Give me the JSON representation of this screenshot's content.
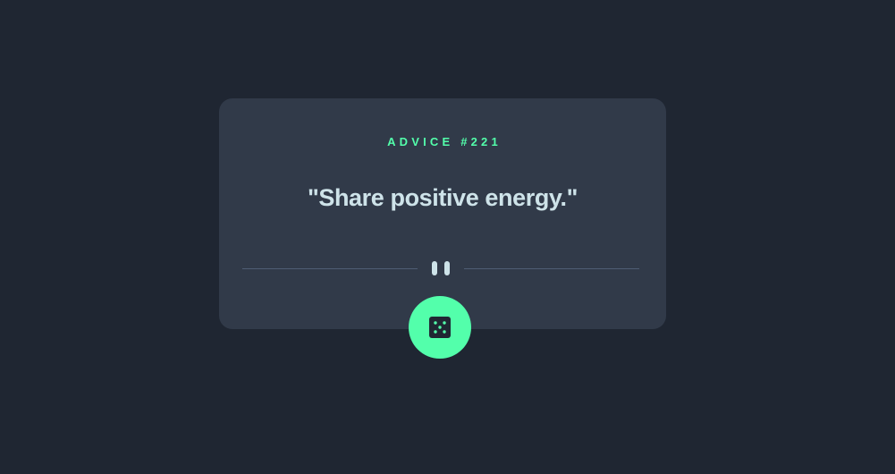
{
  "card": {
    "advice_id": "ADVICE #221",
    "advice_text": "\"Share positive energy.\""
  },
  "icons": {
    "divider": "pause-icon",
    "button": "dice-icon"
  },
  "colors": {
    "background": "#1f2632",
    "card": "#313a49",
    "accent": "#53ffab",
    "text": "#cee3e9",
    "divider": "#4f5d74"
  }
}
